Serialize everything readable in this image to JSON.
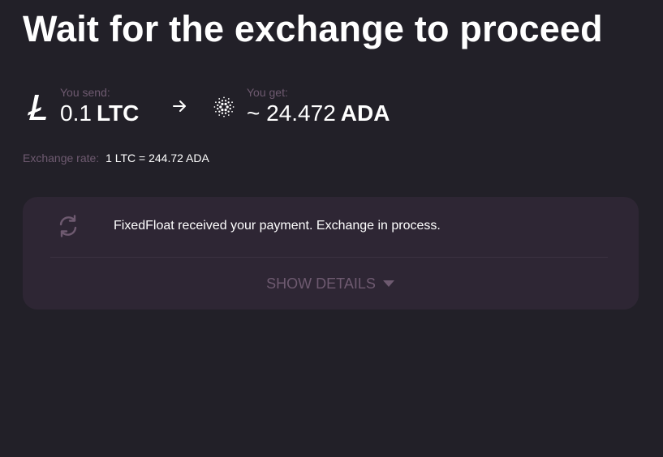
{
  "page": {
    "title": "Wait for the exchange to proceed"
  },
  "send": {
    "label": "You send:",
    "amount": "0.1",
    "currency": "LTC",
    "icon": "litecoin-icon"
  },
  "get": {
    "label": "You get:",
    "amount": "~ 24.472",
    "currency": "ADA",
    "icon": "cardano-icon"
  },
  "rate": {
    "label": "Exchange rate:",
    "value": "1 LTC = 244.72 ADA"
  },
  "status": {
    "icon": "refresh-icon",
    "message": "FixedFloat received your payment. Exchange in process.",
    "details_label": "SHOW DETAILS"
  },
  "colors": {
    "background": "#222028",
    "card": "#2e2634",
    "muted": "#6e5a70",
    "text": "#ffffff"
  }
}
